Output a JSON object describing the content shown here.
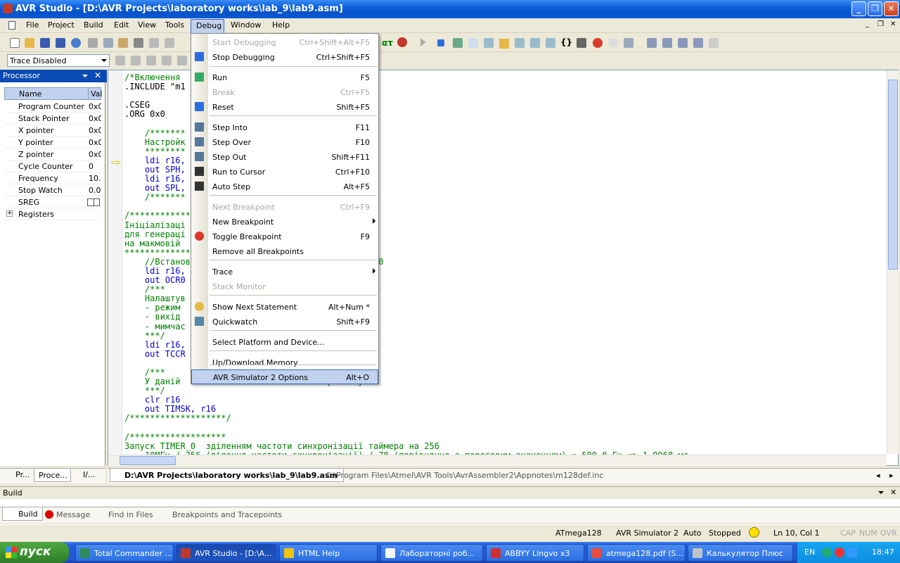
{
  "window": {
    "title": "AVR Studio - [D:\\AVR Projects\\laboratory works\\lab_9\\lab9.asm]",
    "min": "_",
    "max": "❐",
    "close": "✕"
  },
  "menubar": {
    "items": [
      "File",
      "Project",
      "Build",
      "Edit",
      "View",
      "Tools",
      "Debug",
      "Window",
      "Help"
    ],
    "doc_min": "_",
    "doc_max": "❐",
    "doc_close": "✕"
  },
  "toolbar2": {
    "trace_select": "Trace Disabled"
  },
  "processor_panel": {
    "title": "Processor",
    "col_name": "Name",
    "col_value": "Val",
    "rows": [
      {
        "name": "Program Counter",
        "value": "0x0"
      },
      {
        "name": "Stack Pointer",
        "value": "0x0"
      },
      {
        "name": "X pointer",
        "value": "0x0"
      },
      {
        "name": "Y pointer",
        "value": "0x0"
      },
      {
        "name": "Z pointer",
        "value": "0x0"
      },
      {
        "name": "Cycle Counter",
        "value": "0"
      },
      {
        "name": "Frequency",
        "value": "10.0"
      },
      {
        "name": "Stop Watch",
        "value": "0.0"
      },
      {
        "name": "SREG",
        "value": ""
      },
      {
        "name": "Registers",
        "value": ""
      }
    ]
  },
  "left_tabs": [
    "Pr...",
    "Proce...",
    "I/..."
  ],
  "editor": {
    "lines": [
      "/*Включення                      */",
      ".INCLUDE \"m1",
      "",
      ".CSEG",
      ".ORG 0x0",
      "",
      "    /*******",
      "    Настройк",
      "    ********",
      "    ldi r16,",
      "    out SPH,",
      "    ldi r16,",
      "    out SPL,",
      "    /*******",
      "",
      "/*******************",
      "Ініціалізаці",
      "для генераці",
      "на макмовій",
      "*******************",
      "    //Встанов                        орівняння OCR0",
      "    ldi r16,",
      "    out OCR0",
      "    /***",
      "    Налаштув",
      "    - режим",
      "    - вихід                        b00)",
      "    - мимчас                     , CS00 = 0b000)",
      "    ***/",
      "    ldi r16,",
      "    out TCCR",
      "",
      "    /***",
      "    У даній                       е використовуємо",
      "    ***/",
      "    clr r16",
      "    out TIMSK, r16",
      "/*******************/",
      "",
      "/*******************",
      "Запуск TIMER_0  зділенням частоти синхронізації таймера на 256",
      "    10МГц / 256 (ділення частоти синхронізації) / 78 (порівняння з пороговим значенням) = 500,8 Гц => 1,9968 мс"
    ]
  },
  "debug_menu": {
    "items": [
      {
        "label": "Start Debugging",
        "shortcut": "Ctrl+Shift+Alt+F5",
        "disabled": true
      },
      {
        "label": "Stop Debugging",
        "shortcut": "Ctrl+Shift+F5"
      },
      {
        "label": "Run",
        "shortcut": "F5"
      },
      {
        "label": "Break",
        "shortcut": "Ctrl+F5",
        "disabled": true
      },
      {
        "label": "Reset",
        "shortcut": "Shift+F5"
      },
      {
        "label": "Step Into",
        "shortcut": "F11"
      },
      {
        "label": "Step Over",
        "shortcut": "F10"
      },
      {
        "label": "Step Out",
        "shortcut": "Shift+F11"
      },
      {
        "label": "Run to Cursor",
        "shortcut": "Ctrl+F10"
      },
      {
        "label": "Auto Step",
        "shortcut": "Alt+F5"
      },
      {
        "label": "Next Breakpoint",
        "shortcut": "Ctrl+F9",
        "disabled": true
      },
      {
        "label": "New Breakpoint",
        "shortcut": ""
      },
      {
        "label": "Toggle Breakpoint",
        "shortcut": "F9"
      },
      {
        "label": "Remove all Breakpoints",
        "shortcut": ""
      },
      {
        "label": "Trace",
        "shortcut": ""
      },
      {
        "label": "Stack Monitor",
        "shortcut": "",
        "disabled": true
      },
      {
        "label": "Show Next Statement",
        "shortcut": "Alt+Num *"
      },
      {
        "label": "Quickwatch",
        "shortcut": "Shift+F9"
      },
      {
        "label": "Select Platform and Device...",
        "shortcut": ""
      },
      {
        "label": "Up/Download Memory",
        "shortcut": ""
      },
      {
        "label": "AVR Simulator 2 Options",
        "shortcut": "Alt+O",
        "selected": true
      }
    ]
  },
  "doc_tabs": [
    {
      "label": "D:\\AVR Projects\\laboratory works\\lab_9\\lab9.asm",
      "active": true
    },
    {
      "label": "C:\\Program Files\\Atmel\\AVR Tools\\AvrAssembler2\\Appnotes\\m128def.inc",
      "active": false
    }
  ],
  "build_panel": {
    "title": "Build",
    "tabs": [
      "Build",
      "Message",
      "Find in Files",
      "Breakpoints and Tracepoints"
    ]
  },
  "statusbar": {
    "device": "ATmega128",
    "platform": "AVR Simulator 2",
    "mode": "Auto",
    "state": "Stopped",
    "position": "Ln 10, Col 1",
    "caps": "CAP",
    "num": "NUM",
    "ovr": "OVR"
  },
  "taskbar": {
    "start": "пуск",
    "tasks": [
      {
        "label": "Total Commander ...",
        "color": "#2e8b57"
      },
      {
        "label": "AVR Studio - [D:\\A...",
        "color": "#c0392b",
        "active": true
      },
      {
        "label": "HTML Help",
        "color": "#f1c40f"
      },
      {
        "label": "Лабораторні роб...",
        "color": "#f5f5f5"
      },
      {
        "label": "ABBYY Lingvo x3",
        "color": "#d32f2f"
      },
      {
        "label": "atmega128.pdf (S...",
        "color": "#e74c3c"
      },
      {
        "label": "Калькулятор Плюс",
        "color": "#bdc3c7"
      }
    ],
    "lang": "EN",
    "clock": "18:47"
  },
  "colors": {
    "titlebar": "#0a5fd8",
    "menu_highlight": "#c1d2ee",
    "selection_border": "#316ac5",
    "comment": "#008000",
    "keyword": "#0000c8",
    "processor_header": "#0b4cb4"
  }
}
